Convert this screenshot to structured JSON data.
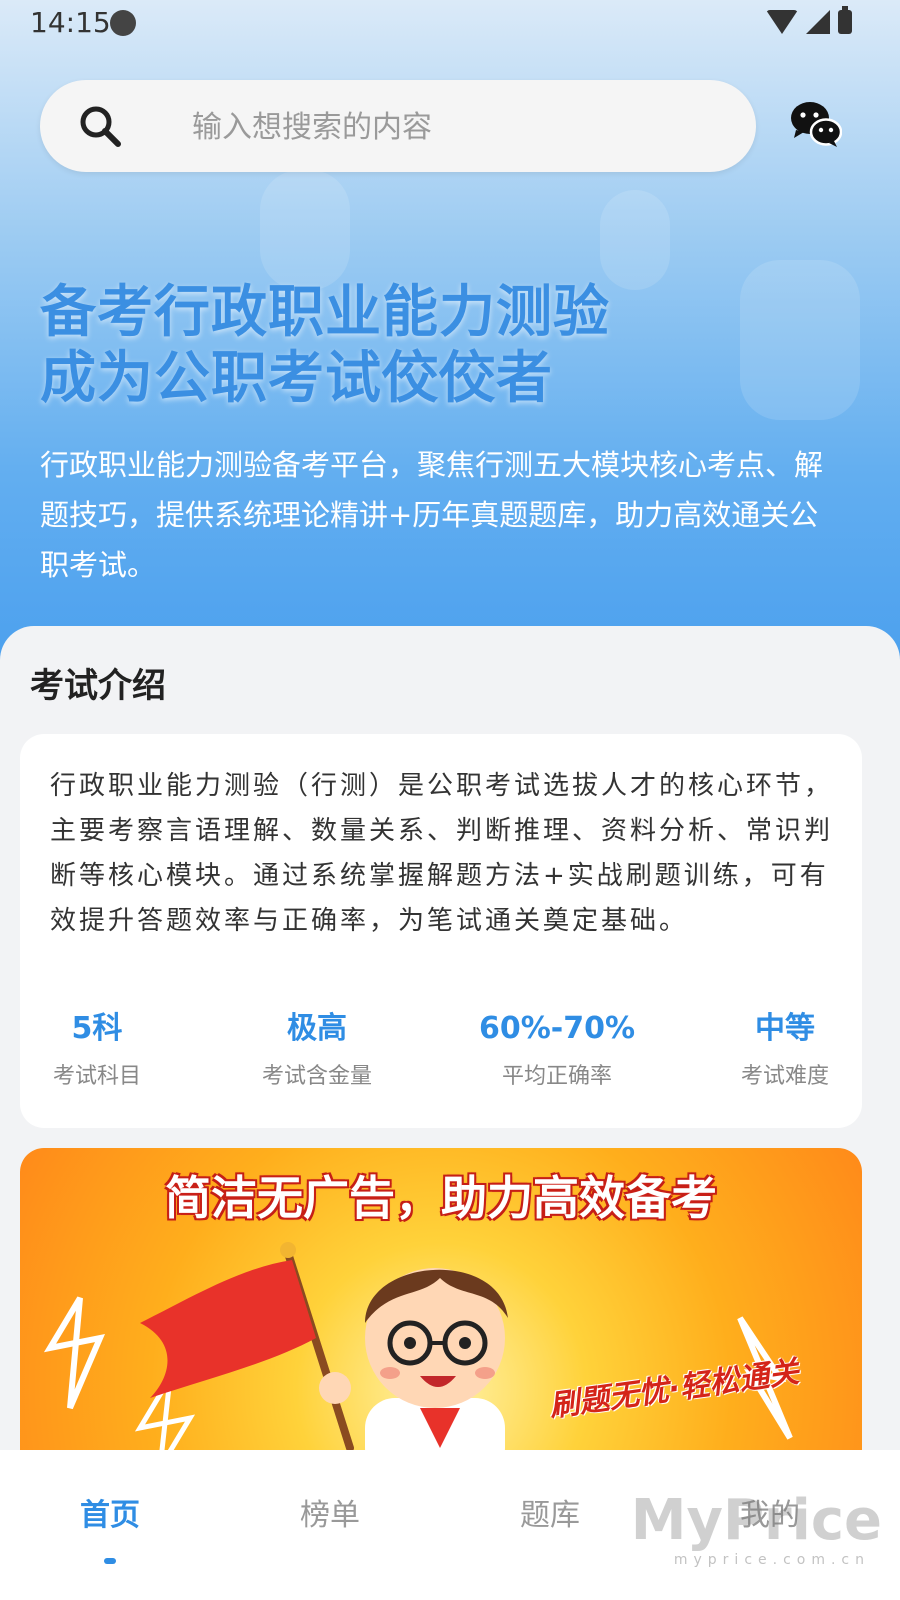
{
  "status_bar": {
    "time": "14:15"
  },
  "search": {
    "placeholder": "输入想搜索的内容"
  },
  "hero": {
    "title_line1": "备考行政职业能力测验",
    "title_line2": "成为公职考试佼佼者",
    "description": "行政职业能力测验备考平台，聚焦行测五大模块核心考点、解题技巧，提供系统理论精讲+历年真题题库，助力高效通关公职考试。"
  },
  "exam_intro": {
    "section_title": "考试介绍",
    "text": "行政职业能力测验（行测）是公职考试选拔人才的核心环节，主要考察言语理解、数量关系、判断推理、资料分析、常识判断等核心模块。通过系统掌握解题方法+实战刷题训练，可有效提升答题效率与正确率，为笔试通关奠定基础。",
    "stats": [
      {
        "value": "5科",
        "label": "考试科目"
      },
      {
        "value": "极高",
        "label": "考试含金量"
      },
      {
        "value": "60%-70%",
        "label": "平均正确率"
      },
      {
        "value": "中等",
        "label": "考试难度"
      }
    ]
  },
  "banner": {
    "title": "简洁无广告，助力高效备考",
    "slogan": "刷题无忧·轻松通关"
  },
  "bottom_nav": {
    "items": [
      {
        "label": "首页"
      },
      {
        "label": "榜单"
      },
      {
        "label": "题库"
      },
      {
        "label": "我的"
      }
    ]
  },
  "watermark": {
    "text": "MyPrice",
    "sub": "myprice.com.cn"
  },
  "colors": {
    "accent": "#2f8de4",
    "hero_title": "#3b8fe2",
    "banner_red": "#d42419"
  }
}
